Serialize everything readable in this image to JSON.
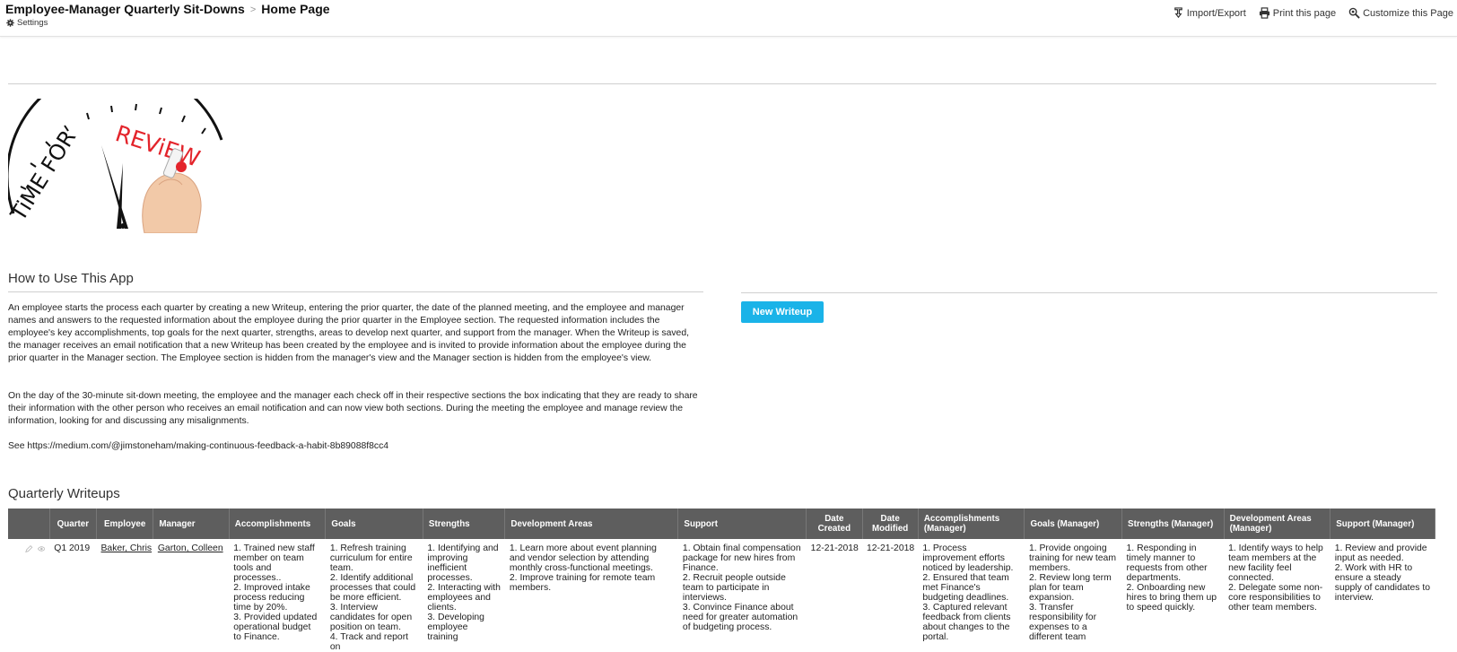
{
  "header": {
    "app_title": "Employee-Manager Quarterly Sit-Downs",
    "separator": ">",
    "page": "Home Page",
    "settings_label": "Settings",
    "actions": [
      {
        "label": "Import/Export",
        "icon": "import-export-icon"
      },
      {
        "label": "Print this page",
        "icon": "print-icon"
      },
      {
        "label": "Customize this Page",
        "icon": "customize-icon"
      }
    ]
  },
  "logo": {
    "text_black": "TiME FOR",
    "text_red": "REViEW",
    "accent_red": "#e3242b"
  },
  "how_to": {
    "heading": "How to Use This App",
    "p1": "An employee starts the process each quarter by creating a new Writeup, entering the prior quarter, the date of the planned meeting, and the employee and manager names and answers to the requested information about the employee during the prior quarter in the Employee section. The requested information includes the employee's key accomplishments, top goals for the next quarter, strengths, areas to develop next quarter, and support from the manager.  When the Writeup is saved, the manager receives  an email notification that a new Writeup has been created by the employee and is invited to provide information about the employee during the prior quarter in the Manager section.  The Employee section is hidden from the manager's view and the Manager section is hidden from the employee's view.",
    "p2": "On the day of the 30-minute sit-down meeting, the employee and the manager each check off in their respective sections the box indicating that they are ready to share their information with the other person who receives an email notification and can now view both sections.  During the meeting the employee and manage review the information, looking for and discussing any misalignments.",
    "p3": "See https://medium.com/@jimstoneham/making-continuous-feedback-a-habit-8b89088f8cc4"
  },
  "new_writeup_button": "New Writeup",
  "button_color": "#1ab3e8",
  "writeups": {
    "heading": "Quarterly Writeups",
    "columns": [
      "",
      "Quarter",
      "Employee",
      "Manager",
      "Accomplishments",
      "Goals",
      "Strengths",
      "Development Areas",
      "Support",
      "Date Created",
      "Date Modified",
      "Accomplishments (Manager)",
      "Goals (Manager)",
      "Strengths (Manager)",
      "Development Areas (Manager)",
      "Support (Manager)"
    ],
    "rows": [
      {
        "quarter": "Q1 2019",
        "employee": "Baker, Chris",
        "manager": "Garton, Colleen",
        "accomplishments": "1. Trained new staff member on team tools and processes..\n2. Improved intake process reducing time by 20%.\n3. Provided updated operational budget  to Finance.",
        "goals": "1. Refresh training curriculum for entire team.\n2. Identify additional processes that could be more efficient.\n3. Interview candidates for open position on team.\n4. Track and report on",
        "strengths": "1. Identifying and improving inefficient processes.\n2. Interacting with employees and clients.\n3. Developing employee training",
        "development": "1. Learn more about event planning and vendor selection by attending monthly cross-functional meetings.\n2. Improve training for remote team members.",
        "support": "1. Obtain final compensation package for new hires from Finance.\n2. Recruit people outside team to participate in interviews.\n3. Convince Finance about need for greater automation of budgeting process.",
        "created": "12-21-2018",
        "modified": "12-21-2018",
        "acc_mgr": "1.  Process improvement efforts noticed by leadership.\n2. Ensured that team met Finance's budgeting deadlines.\n3. Captured relevant feedback from clients about changes to the portal.",
        "goals_mgr": "1.  Provide ongoing training for new team members.\n2. Review long term plan for team expansion.\n3. Transfer responsibility for expenses to a different team",
        "str_mgr": "1. Responding in timely manner to requests from other departments.\n2. Onboarding new hires to bring them up to speed quickly.",
        "dev_mgr": "1. Identify ways to help team members at the new facility feel connected.\n2. Delegate some non-core responsibilities to other team members.",
        "sup_mgr": "1. Review and provide input as needed.\n2. Work with HR to ensure a steady supply of candidates to interview."
      }
    ]
  },
  "header_color": "#5e5e5e"
}
